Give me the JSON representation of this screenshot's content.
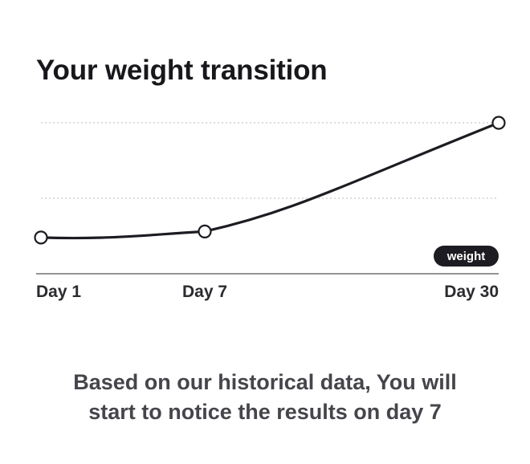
{
  "title": "Your weight transition",
  "footer": {
    "line1": "Based on our historical data, You will",
    "line2": "start to notice the results on day 7"
  },
  "colors": {
    "line": "#1c1c22",
    "grid": "#c8c8c8",
    "axis": "#555555",
    "legend_bg": "#1c1c22",
    "legend_text": "#ffffff",
    "marker_fill": "#ffffff"
  },
  "chart_data": {
    "type": "line",
    "title": "Your weight transition",
    "x": [
      1,
      7,
      30
    ],
    "x_tick_labels": [
      "Day 1",
      "Day 7",
      "Day 30"
    ],
    "xlim": [
      1,
      30
    ],
    "ylim": [
      0,
      1
    ],
    "y_axis_labels": false,
    "grid": "horizontal dotted",
    "legend_position": "bottom-right",
    "series": [
      {
        "name": "weight",
        "values": [
          0.24,
          0.28,
          1.0
        ]
      }
    ]
  }
}
